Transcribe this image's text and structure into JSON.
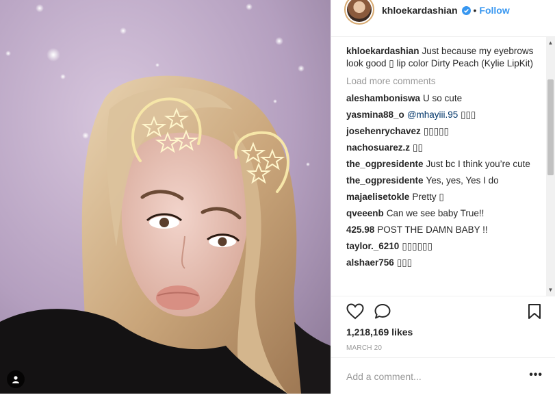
{
  "header": {
    "username": "khloekardashian",
    "separator": "•",
    "follow_label": "Follow",
    "verified_icon": "verified-badge-icon"
  },
  "caption": {
    "user": "khloekardashian",
    "text": "Just because my eyebrows look good ▯ lip color Dirty Peach (Kylie LipKit)"
  },
  "load_more": "Load more comments",
  "comments": [
    {
      "user": "aleshamboniswa",
      "text": "U so cute"
    },
    {
      "user": "yasmina88_o",
      "mention": "@mhayiii.95",
      "text": "▯▯▯"
    },
    {
      "user": "josehenrychavez",
      "text": "▯▯▯▯▯"
    },
    {
      "user": "nachosuarez.z",
      "text": "▯▯"
    },
    {
      "user": "the_ogpresidente",
      "text": "Just bc I think you’re cute"
    },
    {
      "user": "the_ogpresidente",
      "text": "Yes, yes, Yes I do"
    },
    {
      "user": "majaelisetokle",
      "text": "Pretty ▯"
    },
    {
      "user": "qveeenb",
      "text": "Can we see baby True!!"
    },
    {
      "user": "425.98",
      "text": "POST THE DAMN BABY !!"
    },
    {
      "user": "taylor._6210",
      "text": "▯▯▯▯▯▯"
    },
    {
      "user": "alshaer756",
      "text": "▯▯▯"
    }
  ],
  "actions": {
    "like_icon": "heart-icon",
    "comment_icon": "speech-bubble-icon",
    "save_icon": "bookmark-icon",
    "likes_text": "1,218,169 likes",
    "date": "MARCH 20"
  },
  "add_comment": {
    "placeholder": "Add a comment...",
    "more_icon": "•••"
  },
  "colors": {
    "follow_blue": "#3897f0",
    "mention_blue": "#003569",
    "muted": "#999999"
  }
}
